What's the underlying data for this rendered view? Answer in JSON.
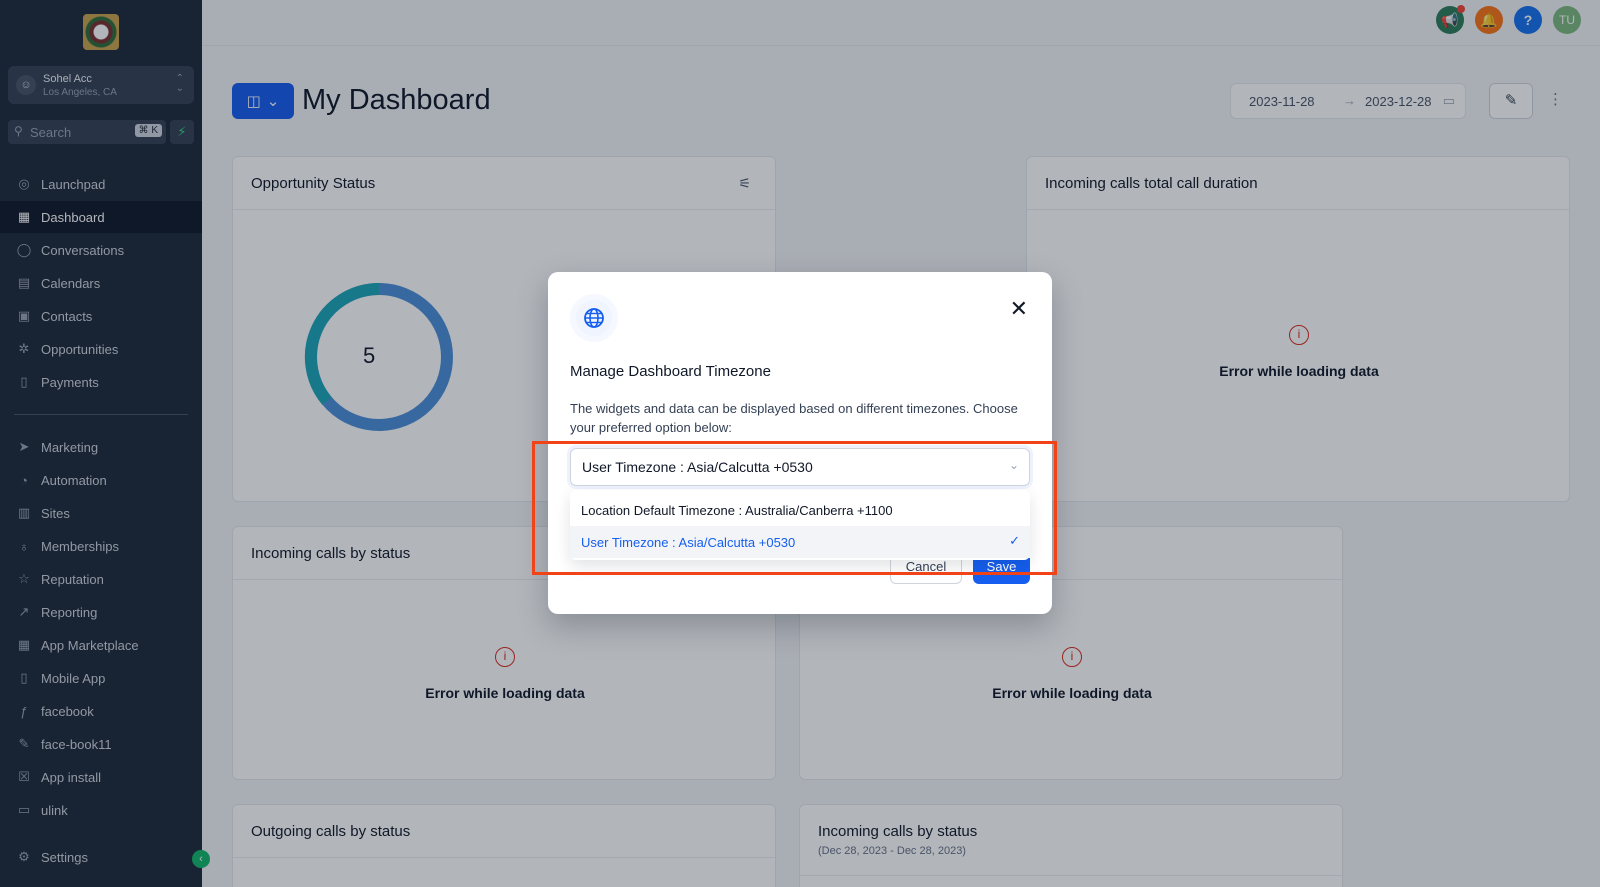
{
  "account": {
    "name": "Sohel Acc",
    "location": "Los Angeles, CA"
  },
  "search": {
    "placeholder": "Search",
    "shortcut": "⌘ K"
  },
  "sidebar": {
    "items": [
      {
        "label": "Launchpad",
        "icon": "rocket-icon"
      },
      {
        "label": "Dashboard",
        "icon": "grid-icon",
        "active": true
      },
      {
        "label": "Conversations",
        "icon": "chat-icon"
      },
      {
        "label": "Calendars",
        "icon": "calendar-icon"
      },
      {
        "label": "Contacts",
        "icon": "contacts-icon"
      },
      {
        "label": "Opportunities",
        "icon": "funnel-icon"
      },
      {
        "label": "Payments",
        "icon": "receipt-icon"
      },
      {
        "label": "Marketing",
        "icon": "send-icon"
      },
      {
        "label": "Automation",
        "icon": "automation-icon"
      },
      {
        "label": "Sites",
        "icon": "sites-icon"
      },
      {
        "label": "Memberships",
        "icon": "award-icon"
      },
      {
        "label": "Reputation",
        "icon": "star-icon"
      },
      {
        "label": "Reporting",
        "icon": "trend-icon"
      },
      {
        "label": "App Marketplace",
        "icon": "apps-icon"
      },
      {
        "label": "Mobile App",
        "icon": "mobile-icon"
      },
      {
        "label": "facebook",
        "icon": "fb-icon"
      },
      {
        "label": "face-book11",
        "icon": "wrench-icon"
      },
      {
        "label": "App install",
        "icon": "x-box-icon"
      },
      {
        "label": "ulink",
        "icon": "link-box-icon"
      }
    ],
    "settings_label": "Settings"
  },
  "header": {
    "title": "My Dashboard",
    "date_start": "2023-11-28",
    "date_end": "2023-12-28"
  },
  "cards": {
    "opportunity_status": {
      "title": "Opportunity Status",
      "value": "5"
    },
    "incoming_duration": {
      "title": "Incoming calls total call duration",
      "error": "Error while loading data"
    },
    "incoming_status_1": {
      "title": "Incoming calls by status",
      "error": "Error while loading data"
    },
    "incoming_status_2": {
      "error": "Error while loading data"
    },
    "outgoing_status": {
      "title": "Outgoing calls by status"
    },
    "incoming_status_3": {
      "title": "Incoming calls by status",
      "subtitle": "(Dec 28, 2023 - Dec 28, 2023)"
    }
  },
  "user_avatar": "TU",
  "modal": {
    "title": "Manage Dashboard Timezone",
    "description": "The widgets and data can be displayed based on different timezones. Choose your preferred option below:",
    "selected": "User Timezone : Asia/Calcutta +0530",
    "options": [
      {
        "label": "Location Default Timezone : Australia/Canberra +1100",
        "selected": false
      },
      {
        "label": "User Timezone : Asia/Calcutta +0530",
        "selected": true
      }
    ],
    "cancel_label": "Cancel",
    "save_label": "Save"
  },
  "colors": {
    "primary": "#155eef",
    "sidebar_bg": "#1d2939",
    "error": "#d92d20",
    "highlight": "#f04418"
  }
}
